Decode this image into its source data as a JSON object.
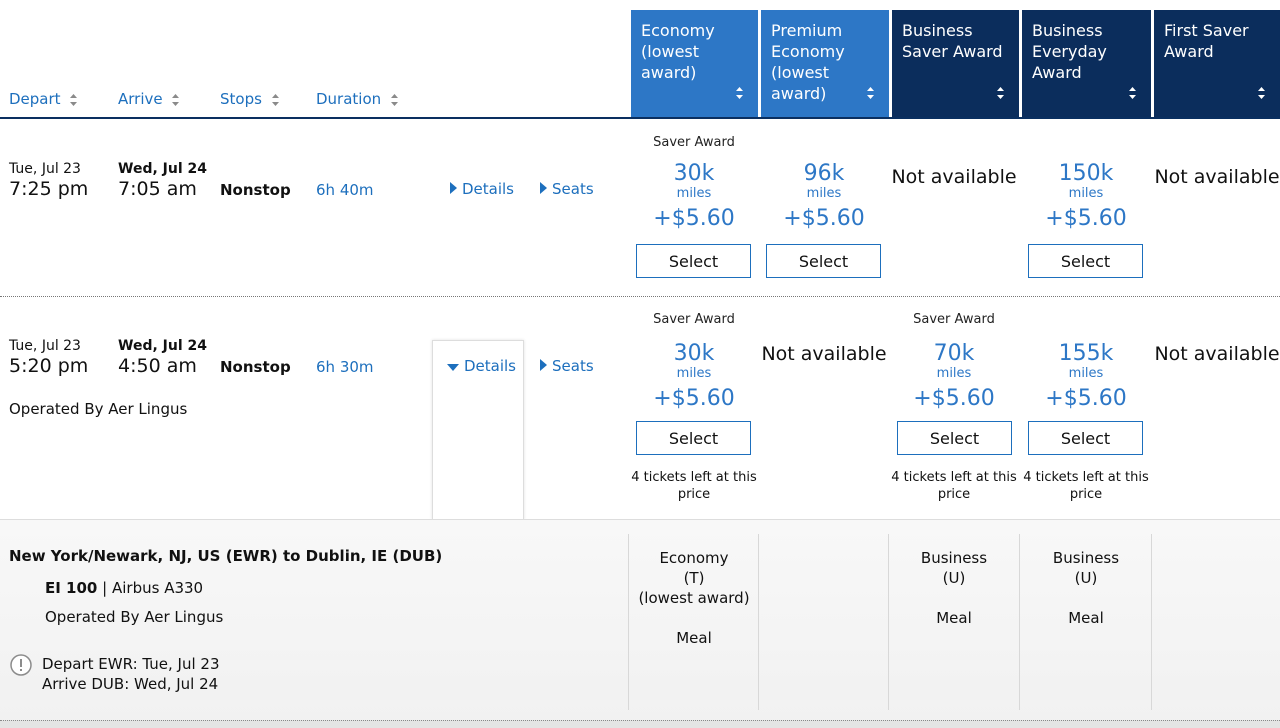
{
  "header": {
    "sort_columns": [
      "Depart",
      "Arrive",
      "Stops",
      "Duration"
    ],
    "fare_columns": [
      "Economy\n(lowest\naward)",
      "Premium\nEconomy\n(lowest\naward)",
      "Business\nSaver Award",
      "Business\nEveryday\nAward",
      "First Saver\nAward"
    ]
  },
  "links": {
    "details": "Details",
    "seats": "Seats"
  },
  "rows": [
    {
      "depart_date": "Tue, Jul 23",
      "depart_time": "7:25 pm",
      "arrive_date": "Wed, Jul 24",
      "arrive_time": "7:05 am",
      "stops": "Nonstop",
      "duration": "6h 40m",
      "fares": [
        {
          "note": "Saver Award",
          "miles": "30k",
          "unit": "miles",
          "tax": "+$5.60",
          "button": "Select"
        },
        {
          "miles": "96k",
          "unit": "miles",
          "tax": "+$5.60",
          "button": "Select"
        },
        {
          "status": "Not available"
        },
        {
          "miles": "150k",
          "unit": "miles",
          "tax": "+$5.60",
          "button": "Select"
        },
        {
          "status": "Not available"
        }
      ]
    },
    {
      "depart_date": "Tue, Jul 23",
      "depart_time": "5:20 pm",
      "arrive_date": "Wed, Jul 24",
      "arrive_time": "4:50 am",
      "stops": "Nonstop",
      "duration": "6h 30m",
      "operated_by": "Operated By Aer Lingus",
      "fares": [
        {
          "note": "Saver Award",
          "miles": "30k",
          "unit": "miles",
          "tax": "+$5.60",
          "button": "Select",
          "tickets_left": "4 tickets left at this price"
        },
        {
          "status": "Not available"
        },
        {
          "note": "Saver Award",
          "miles": "70k",
          "unit": "miles",
          "tax": "+$5.60",
          "button": "Select",
          "tickets_left": "4 tickets left at this price"
        },
        {
          "miles": "155k",
          "unit": "miles",
          "tax": "+$5.60",
          "button": "Select",
          "tickets_left": "4 tickets left at this price"
        },
        {
          "status": "Not available"
        }
      ]
    }
  ],
  "detail": {
    "route": "New York/Newark, NJ, US (EWR) to Dublin, IE (DUB)",
    "flight_number": "EI 100",
    "separator": "|",
    "aircraft": "Airbus A330",
    "operated_by": "Operated By Aer Lingus",
    "depart": "Depart EWR: Tue, Jul 23",
    "arrive": "Arrive DUB: Wed, Jul 24",
    "cabins": [
      {
        "lines": [
          "Economy",
          "(T)",
          "(lowest award)"
        ],
        "meal": "Meal"
      },
      {
        "lines": [
          "Business",
          "(U)"
        ],
        "meal": "Meal"
      },
      {
        "lines": [
          "Business",
          "(U)"
        ],
        "meal": "Meal"
      }
    ]
  },
  "colors": {
    "link_blue": "#1d6fbd",
    "header_light_blue": "#2d77c6",
    "header_dark_navy": "#0b2d5c"
  },
  "icons": [
    "sort-caret-icon",
    "caret-right-icon",
    "caret-down-icon",
    "alert-icon"
  ]
}
